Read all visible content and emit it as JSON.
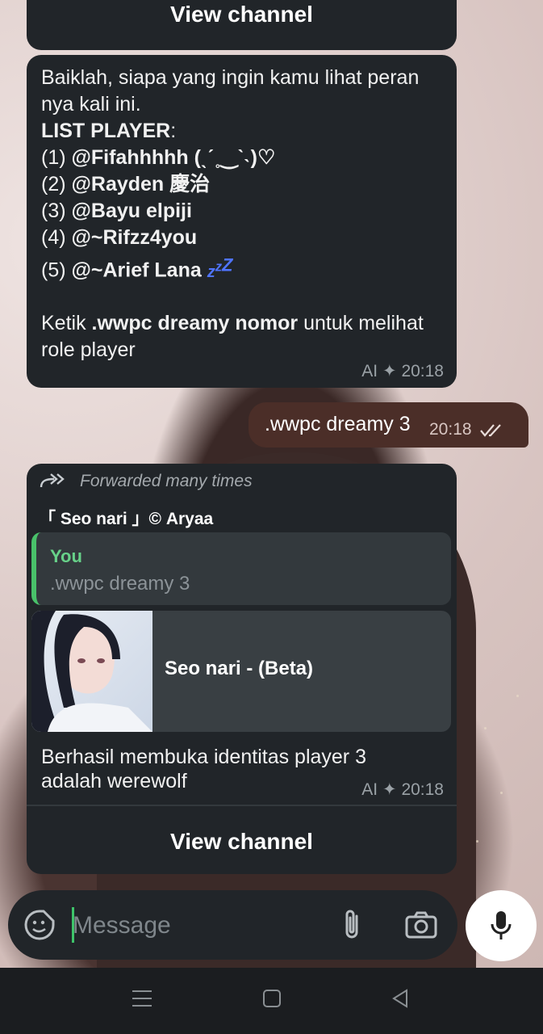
{
  "top_card": {
    "view_channel_label": "View channel"
  },
  "message1": {
    "intro": "Baiklah, siapa yang ingin kamu lihat peran nya kali ini.",
    "list_title": "LIST PLAYER",
    "players": [
      {
        "num": "(1)",
        "name": "@Fifahhhhh (ˎˊ˳‿ˋ˴)♡"
      },
      {
        "num": "(2)",
        "name": "@Rayden 慶治"
      },
      {
        "num": "(3)",
        "name": "@Bayu elpiji"
      },
      {
        "num": "(4)",
        "name": "@~Rifzz4you"
      },
      {
        "num": "(5)",
        "name": "@~Arief Lana",
        "emoji": "zzz"
      }
    ],
    "footer_pre": "Ketik ",
    "footer_cmd": ".wwpc dreamy nomor",
    "footer_post": " untuk melihat role player",
    "badge": "AI",
    "time": "20:18"
  },
  "outgoing": {
    "text": ".wwpc dreamy 3",
    "time": "20:18"
  },
  "forwarded": {
    "forwarded_label": "Forwarded many times",
    "author": "「 Seo nari 」© Aryaa",
    "quote_name": "You",
    "quote_text": ".wwpc dreamy 3",
    "preview_title": "Seo nari - (Beta)",
    "text": "Berhasil membuka identitas player 3 adalah werewolf",
    "badge": "AI",
    "time": "20:18",
    "view_channel_label": "View channel"
  },
  "composer": {
    "placeholder": "Message"
  },
  "colors": {
    "bubble_in": "#212529",
    "bubble_out": "#4b2e28",
    "accent_green": "#49c26a"
  }
}
